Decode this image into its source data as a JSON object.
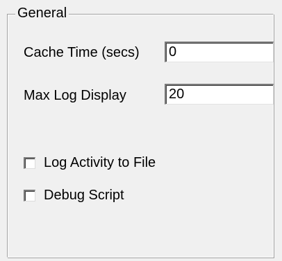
{
  "group": {
    "title": "General"
  },
  "fields": {
    "cache_time": {
      "label": "Cache Time (secs)",
      "value": "0"
    },
    "max_log_display": {
      "label": "Max Log Display",
      "value": "20"
    }
  },
  "checkboxes": {
    "log_activity": {
      "label": "Log Activity to File",
      "checked": false
    },
    "debug_script": {
      "label": "Debug Script",
      "checked": false
    }
  }
}
